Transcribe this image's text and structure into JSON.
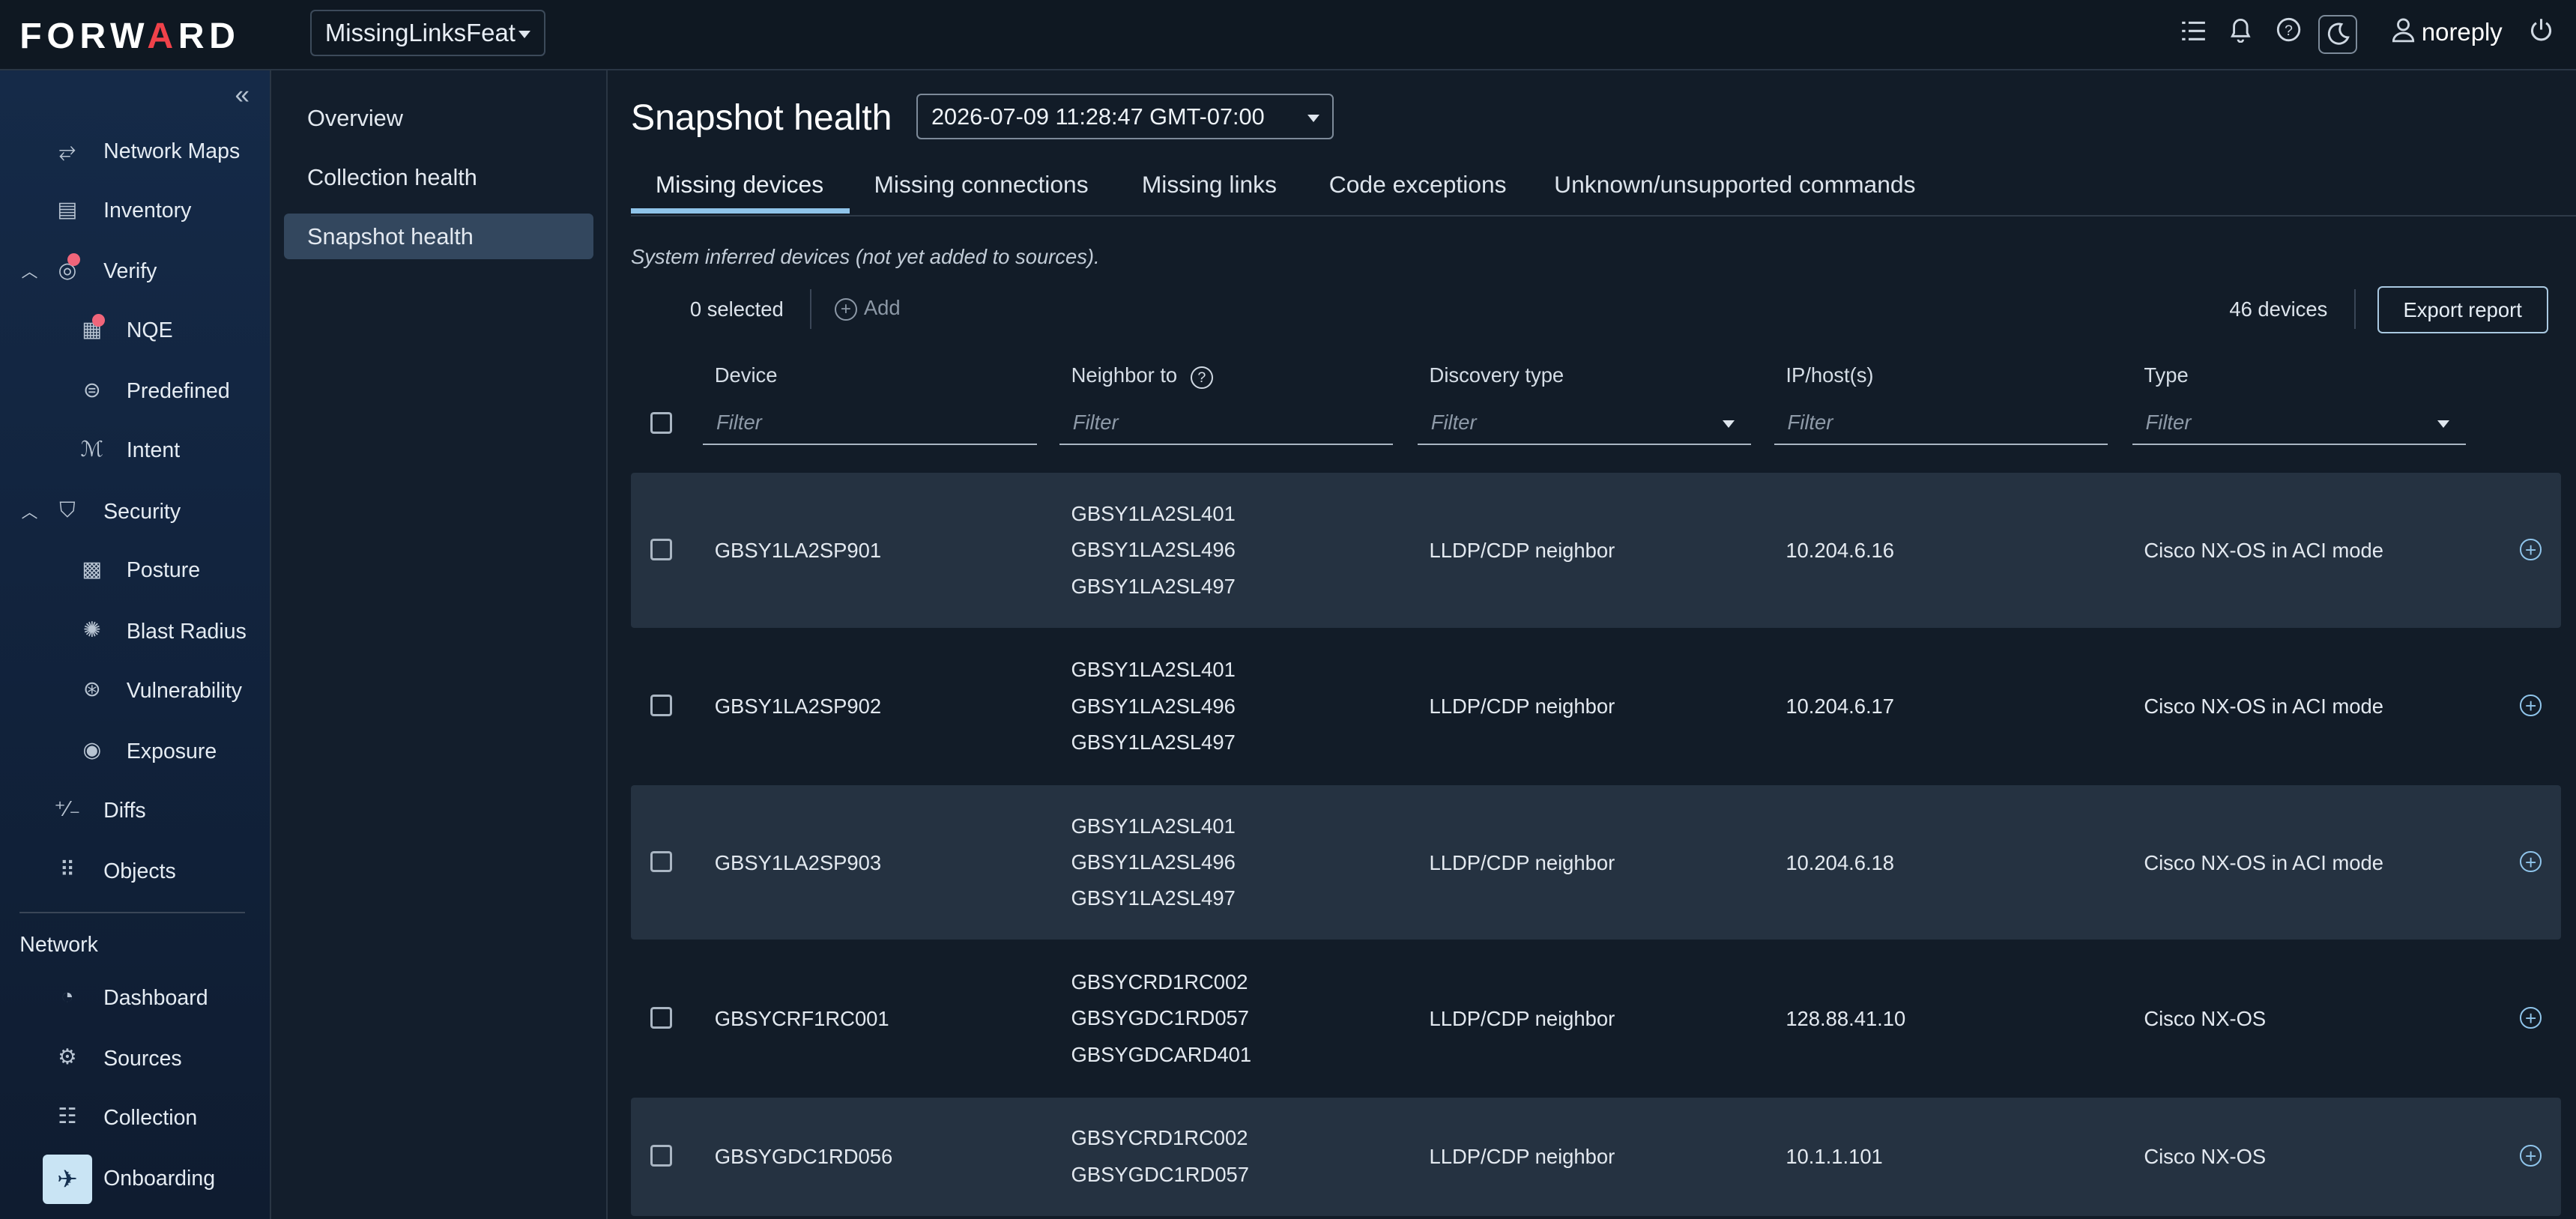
{
  "app": {
    "logo": "FORWARD",
    "workspace": "MissingLinksFeat",
    "user": "noreply"
  },
  "top_icons": [
    "list-icon",
    "bell-icon",
    "help-icon",
    "moon-icon",
    "user-icon",
    "power-icon"
  ],
  "sidebar": {
    "items": [
      {
        "label": "Network Maps",
        "icon": "network-maps-icon"
      },
      {
        "label": "Inventory",
        "icon": "inventory-icon"
      },
      {
        "label": "Verify",
        "icon": "verify-icon"
      },
      {
        "label": "NQE",
        "icon": "nqe-icon"
      },
      {
        "label": "Predefined",
        "icon": "predefined-icon"
      },
      {
        "label": "Intent",
        "icon": "intent-icon"
      },
      {
        "label": "Security",
        "icon": "shield-icon"
      },
      {
        "label": "Posture",
        "icon": "posture-icon"
      },
      {
        "label": "Blast Radius",
        "icon": "blast-radius-icon"
      },
      {
        "label": "Vulnerability",
        "icon": "vulnerability-icon"
      },
      {
        "label": "Exposure",
        "icon": "exposure-icon"
      },
      {
        "label": "Diffs",
        "icon": "diffs-icon"
      },
      {
        "label": "Objects",
        "icon": "objects-icon"
      }
    ],
    "section_network": "Network",
    "network_items": [
      {
        "label": "Dashboard",
        "icon": "dashboard-icon"
      },
      {
        "label": "Sources",
        "icon": "sources-icon"
      },
      {
        "label": "Collection",
        "icon": "collection-icon"
      },
      {
        "label": "Onboarding",
        "icon": "onboarding-icon"
      }
    ]
  },
  "subnav": {
    "items": [
      "Overview",
      "Collection health",
      "Snapshot health"
    ],
    "active": "Snapshot health"
  },
  "main": {
    "title": "Snapshot health",
    "snapshot": "2026-07-09 11:28:47 GMT-07:00",
    "tabs": [
      "Missing devices",
      "Missing connections",
      "Missing links",
      "Code exceptions",
      "Unknown/unsupported commands"
    ],
    "active_tab": "Missing devices",
    "hint": "System inferred devices (not yet added to sources).",
    "selected": "0 selected",
    "add_label": "Add",
    "device_count": "46 devices",
    "export_label": "Export report",
    "columns": [
      "Device",
      "Neighbor to",
      "Discovery type",
      "IP/host(s)",
      "Type"
    ],
    "filter_placeholder": "Filter",
    "rows": [
      {
        "device": "GBSY1LA2SP901",
        "neighbors": [
          "GBSY1LA2SL401",
          "GBSY1LA2SL496",
          "GBSY1LA2SL497"
        ],
        "discovery": "LLDP/CDP neighbor",
        "ip": "10.204.6.16",
        "type": "Cisco NX-OS in ACI mode"
      },
      {
        "device": "GBSY1LA2SP902",
        "neighbors": [
          "GBSY1LA2SL401",
          "GBSY1LA2SL496",
          "GBSY1LA2SL497"
        ],
        "discovery": "LLDP/CDP neighbor",
        "ip": "10.204.6.17",
        "type": "Cisco NX-OS in ACI mode"
      },
      {
        "device": "GBSY1LA2SP903",
        "neighbors": [
          "GBSY1LA2SL401",
          "GBSY1LA2SL496",
          "GBSY1LA2SL497"
        ],
        "discovery": "LLDP/CDP neighbor",
        "ip": "10.204.6.18",
        "type": "Cisco NX-OS in ACI mode"
      },
      {
        "device": "GBSYCRF1RC001",
        "neighbors": [
          "GBSYCRD1RC002",
          "GBSYGDC1RD057",
          "GBSYGDCARD401"
        ],
        "discovery": "LLDP/CDP neighbor",
        "ip": "128.88.41.10",
        "type": "Cisco NX-OS"
      },
      {
        "device": "GBSYGDC1RD056",
        "neighbors": [
          "GBSYCRD1RC002",
          "GBSYGDC1RD057"
        ],
        "discovery": "LLDP/CDP neighbor",
        "ip": "10.1.1.101",
        "type": "Cisco NX-OS"
      }
    ]
  }
}
